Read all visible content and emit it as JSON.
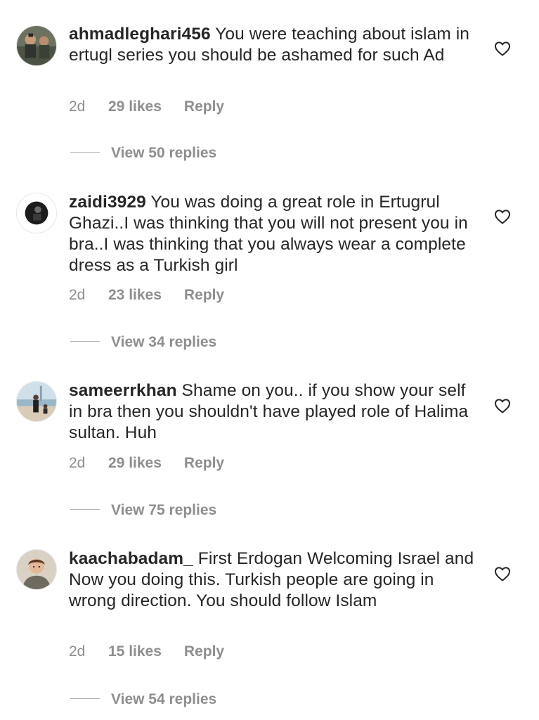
{
  "comments": [
    {
      "username": "ahmadleghari456",
      "text": " You were teaching about islam in ertugl series you should be ashamed for such Ad",
      "time": "2d",
      "likes": "29 likes",
      "reply": "Reply",
      "view_replies": "View 50 replies",
      "avatar": "group-photo-avatar"
    },
    {
      "username": "zaidi3929",
      "text": " You was doing a great role in Ertugrul Ghazi..I was thinking that you will not present you in bra..I was thinking that you always wear a complete dress as a Turkish girl",
      "time": "2d",
      "likes": "23 likes",
      "reply": "Reply",
      "view_replies": "View 34 replies",
      "avatar": "dark-photo-avatar"
    },
    {
      "username": "sameerrkhan",
      "text": " Shame on you.. if you show your self in bra then you shouldn't have played role of Halima sultan. Huh",
      "time": "2d",
      "likes": "29 likes",
      "reply": "Reply",
      "view_replies": "View 75 replies",
      "avatar": "beach-photo-avatar"
    },
    {
      "username": "kaachabadam_",
      "text": " First Erdogan Welcoming Israel and Now you doing this. Turkish people are going in wrong direction. You should follow Islam",
      "time": "2d",
      "likes": "15 likes",
      "reply": "Reply",
      "view_replies": "View 54 replies",
      "avatar": "portrait-photo-avatar"
    }
  ],
  "icons": {
    "like": "heart-outline-icon"
  },
  "colors": {
    "text": "#262626",
    "secondary": "#8e8e8e",
    "background": "#ffffff"
  }
}
